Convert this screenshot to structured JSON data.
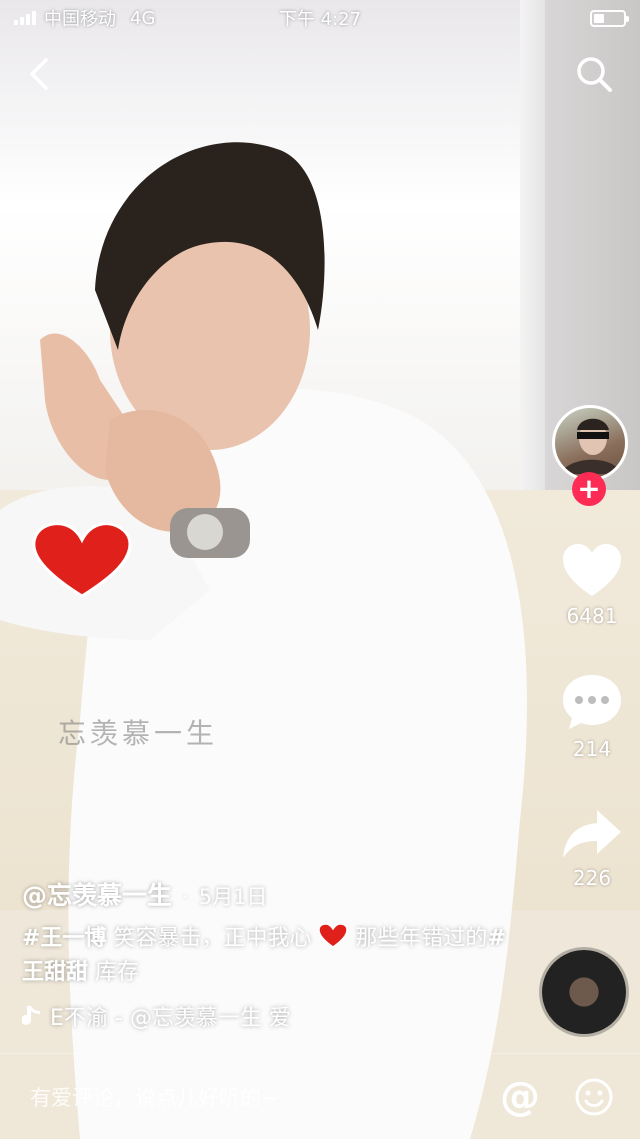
{
  "status_bar": {
    "carrier": "中国移动",
    "network": "4G",
    "time": "下午 4:27"
  },
  "colors": {
    "accent": "#fe2c55",
    "heart": "#e0201b"
  },
  "icons": {
    "back": "chevron-left-icon",
    "search": "search-icon",
    "like": "heart-icon",
    "comment": "speech-bubble-icon",
    "share": "share-arrow-icon",
    "music": "music-note-icon",
    "at": "at-sign-icon",
    "emoji": "smiley-icon"
  },
  "watermark": "忘羡慕一生",
  "actions": {
    "likes": "6481",
    "comments": "214",
    "shares": "226",
    "follow_symbol": "+"
  },
  "post": {
    "author": "@忘羡慕一生",
    "separator": "·",
    "date": "5月1日",
    "tag1": "#王一博",
    "text1": " 笑容暴击，正中我心 ",
    "text2": " 那些年错过的",
    "tag2": "#王甜甜",
    "text3": " 库存",
    "music": "E不渝 - @忘羡慕一生   爱"
  },
  "comment": {
    "placeholder": "有爱评论，说点儿好听的~",
    "at_symbol": "@"
  }
}
